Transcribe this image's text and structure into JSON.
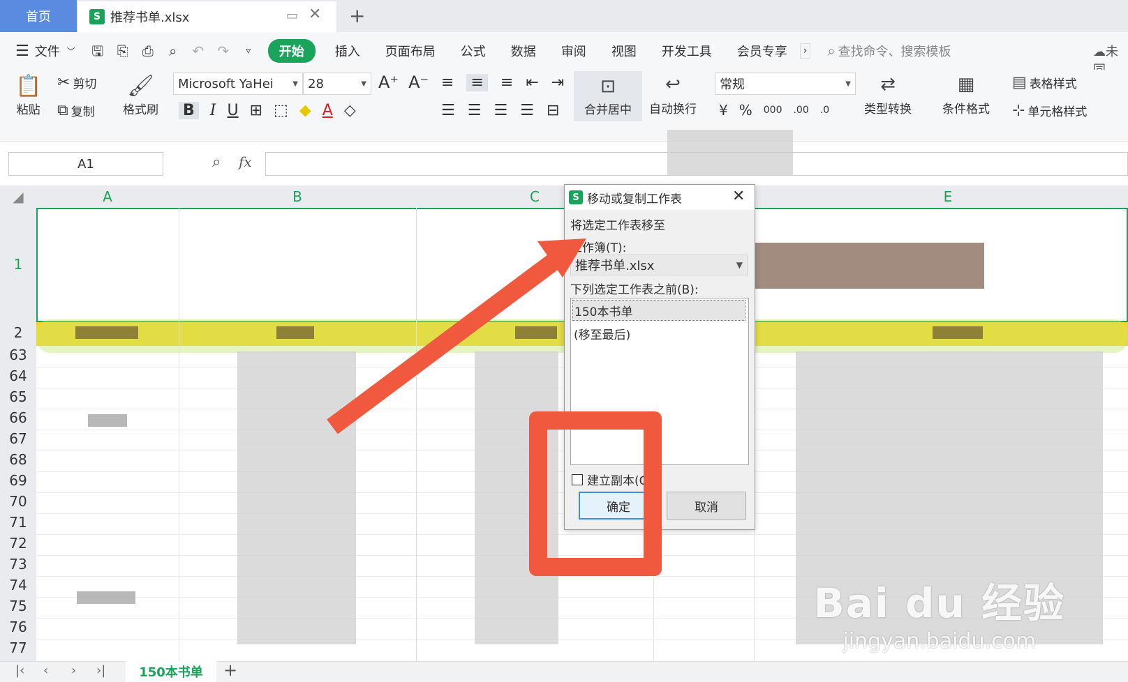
{
  "tabs": {
    "home": "首页",
    "file": "推荐书单.xlsx",
    "new_tab": "+"
  },
  "menu": {
    "file": "文件",
    "items": [
      "开始",
      "插入",
      "页面布局",
      "公式",
      "数据",
      "审阅",
      "视图",
      "开发工具",
      "会员专享"
    ],
    "search_placeholder": "查找命令、搜索模板",
    "cloud": "未同"
  },
  "ribbon": {
    "paste": "粘贴",
    "cut": "剪切",
    "copy": "复制",
    "format_painter": "格式刷",
    "font_name": "Microsoft YaHei",
    "font_size": "28",
    "merge_center": "合并居中",
    "wrap_text": "自动换行",
    "number_format": "常规",
    "type_convert": "类型转换",
    "conditional_format": "条件格式",
    "table_style": "表格样式",
    "cell_style": "单元格样式"
  },
  "formula_bar": {
    "cell_ref": "A1",
    "fx": "fx"
  },
  "columns": [
    "A",
    "B",
    "C",
    "E"
  ],
  "rows": [
    "1",
    "2",
    "63",
    "64",
    "65",
    "66",
    "67",
    "68",
    "69",
    "70",
    "71",
    "72",
    "73",
    "74",
    "75",
    "76",
    "77"
  ],
  "sheet_tab": "150本书单",
  "dialog": {
    "title": "移动或复制工作表",
    "label_move_to": "将选定工作表移至",
    "label_workbook": "工作簿(T):",
    "workbook_value": "推荐书单.xlsx",
    "label_before": "下列选定工作表之前(B):",
    "list": [
      "150本书单",
      "(移至最后)"
    ],
    "create_copy": "建立副本(C)",
    "ok": "确定",
    "cancel": "取消"
  },
  "watermark": {
    "brand": "Bai du 经验",
    "url": "jingyan.baidu.com"
  },
  "colors": {
    "accent": "#1aa35a",
    "home_tab": "#5b8be0",
    "annotation": "#f0593e",
    "header_row": "#f7d31c"
  }
}
